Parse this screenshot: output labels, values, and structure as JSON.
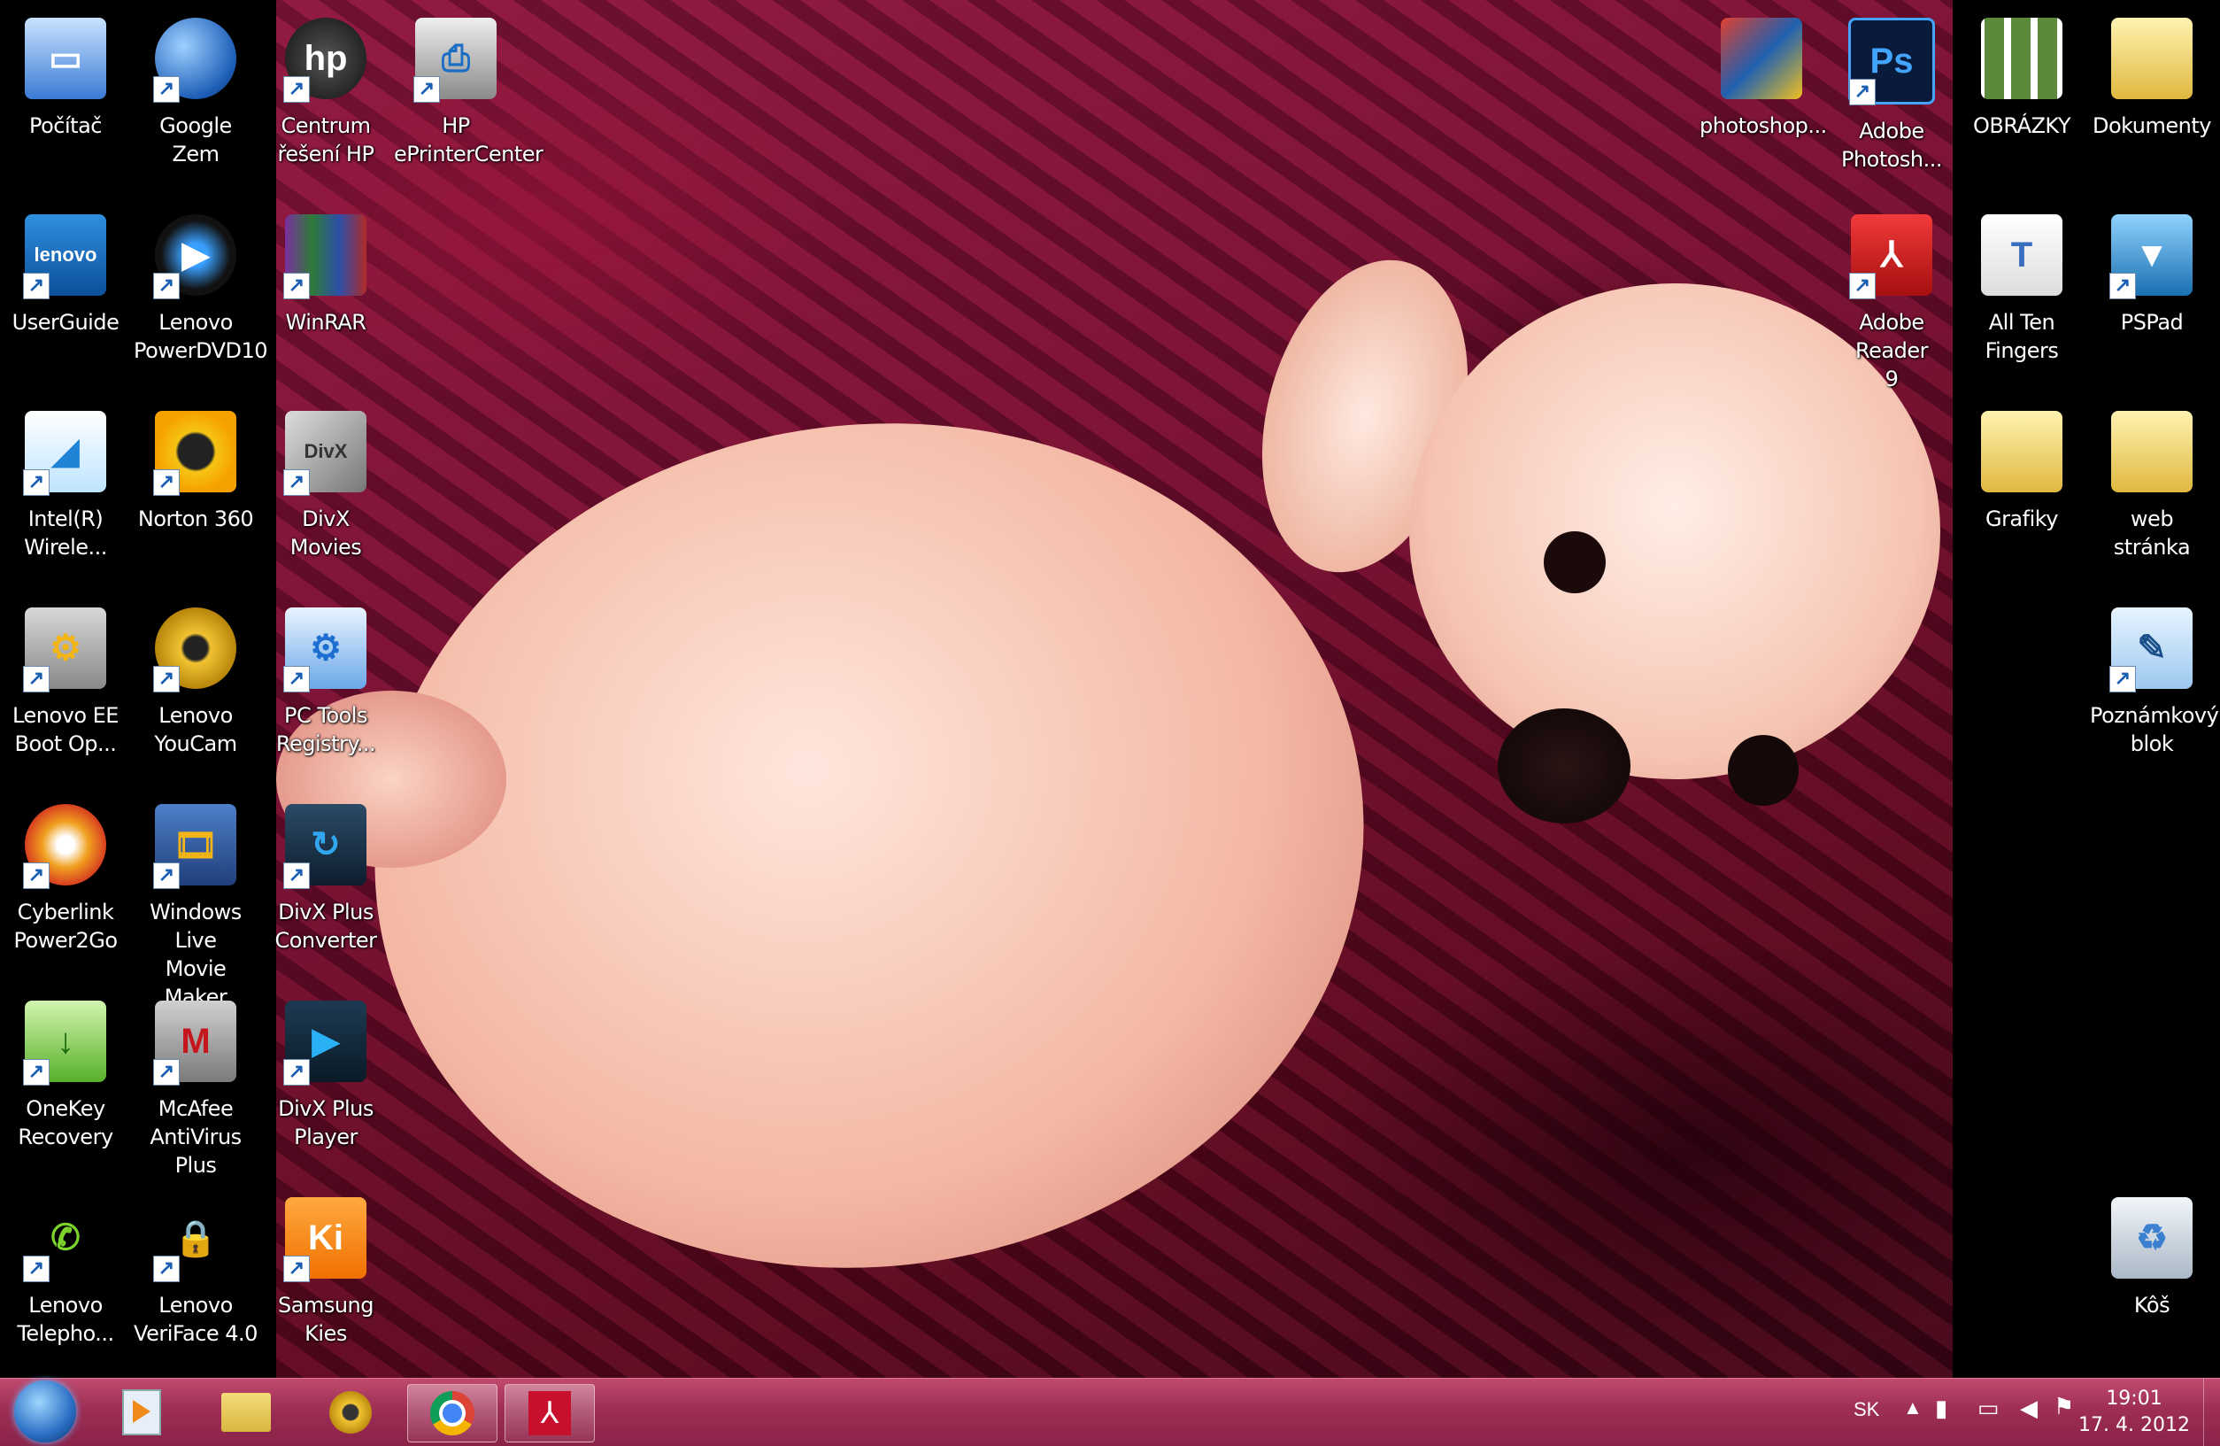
{
  "desktop_icons_left": [
    {
      "id": "pocitac",
      "label": "Počítač",
      "icon": "computer-icon",
      "col": 0,
      "row": 0
    },
    {
      "id": "google-zem",
      "label": "Google Zem",
      "icon": "google-earth-icon",
      "col": 1,
      "row": 0
    },
    {
      "id": "centrum-hp",
      "label": "Centrum\nřešení HP",
      "icon": "hp-icon",
      "col": 2,
      "row": 0
    },
    {
      "id": "hp-eprinter",
      "label": "HP\nePrinterCenter",
      "icon": "printer-icon",
      "col": 3,
      "row": 0
    },
    {
      "id": "userguide",
      "label": "UserGuide",
      "icon": "lenovo-icon",
      "col": 0,
      "row": 1
    },
    {
      "id": "powerdvd",
      "label": "Lenovo\nPowerDVD10",
      "icon": "dvd-player-icon",
      "col": 1,
      "row": 1
    },
    {
      "id": "winrar",
      "label": "WinRAR",
      "icon": "winrar-icon",
      "col": 2,
      "row": 1
    },
    {
      "id": "intel-wireless",
      "label": "Intel(R)\nWirele...",
      "icon": "wireless-icon",
      "col": 0,
      "row": 2
    },
    {
      "id": "norton",
      "label": "Norton 360",
      "icon": "norton-icon",
      "col": 1,
      "row": 2
    },
    {
      "id": "divx-movies",
      "label": "DivX Movies",
      "icon": "divx-icon",
      "col": 2,
      "row": 2
    },
    {
      "id": "lenovo-ee",
      "label": "Lenovo EE\nBoot Op...",
      "icon": "gear-shield-icon",
      "col": 0,
      "row": 3
    },
    {
      "id": "youcam",
      "label": "Lenovo\nYouCam",
      "icon": "webcam-icon",
      "col": 1,
      "row": 3
    },
    {
      "id": "pc-tools",
      "label": "PC Tools\nRegistry...",
      "icon": "registry-icon",
      "col": 2,
      "row": 3
    },
    {
      "id": "power2go",
      "label": "Cyberlink\nPower2Go",
      "icon": "disc-burn-icon",
      "col": 0,
      "row": 4
    },
    {
      "id": "movie-maker",
      "label": "Windows Live\nMovie Maker",
      "icon": "film-icon",
      "col": 1,
      "row": 4
    },
    {
      "id": "divx-converter",
      "label": "DivX Plus\nConverter",
      "icon": "converter-icon",
      "col": 2,
      "row": 4
    },
    {
      "id": "onekey",
      "label": "OneKey\nRecovery",
      "icon": "recovery-icon",
      "col": 0,
      "row": 5
    },
    {
      "id": "mcafee",
      "label": "McAfee\nAntiVirus Plus",
      "icon": "mcafee-icon",
      "col": 1,
      "row": 5
    },
    {
      "id": "divx-player",
      "label": "DivX Plus\nPlayer",
      "icon": "play-icon",
      "col": 2,
      "row": 5
    },
    {
      "id": "lenovo-telephony",
      "label": "Lenovo\nTelepho...",
      "icon": "phone-icon",
      "col": 0,
      "row": 6
    },
    {
      "id": "veriface",
      "label": "Lenovo\nVeriFace 4.0",
      "icon": "lock-face-icon",
      "col": 1,
      "row": 6
    },
    {
      "id": "kies",
      "label": "Samsung Kies",
      "icon": "kies-icon",
      "col": 2,
      "row": 6
    }
  ],
  "desktop_icons_right": [
    {
      "id": "photoshop-file",
      "label": "photoshop...",
      "icon": "photoshop-book-icon",
      "col": 0,
      "row": 0
    },
    {
      "id": "adobe-ps",
      "label": "Adobe\nPhotosh...",
      "icon": "photoshop-icon",
      "col": 1,
      "row": 0
    },
    {
      "id": "obrazky",
      "label": "OBRÁZKY",
      "icon": "image-grid-icon",
      "col": 2,
      "row": 0
    },
    {
      "id": "dokumenty",
      "label": "Dokumenty",
      "icon": "folder-icon",
      "col": 3,
      "row": 0
    },
    {
      "id": "adobe-reader",
      "label": "Adobe Reader\n9",
      "icon": "acrobat-icon",
      "col": 1,
      "row": 1
    },
    {
      "id": "all-ten",
      "label": "All Ten\nFingers",
      "icon": "font-file-icon",
      "col": 2,
      "row": 1
    },
    {
      "id": "pspad",
      "label": "PSPad",
      "icon": "pspad-icon",
      "col": 3,
      "row": 1
    },
    {
      "id": "grafiky",
      "label": "Grafiky",
      "icon": "folder-icon",
      "col": 2,
      "row": 2
    },
    {
      "id": "web-stranka",
      "label": "web stránka",
      "icon": "folder-icon",
      "col": 3,
      "row": 2
    },
    {
      "id": "poznamkovy",
      "label": "Poznámkový\nblok",
      "icon": "notepad-icon",
      "col": 3,
      "row": 3
    },
    {
      "id": "kos",
      "label": "Kôš",
      "icon": "recycle-bin-icon",
      "col": 3,
      "row": 6
    }
  ],
  "taskbar": {
    "start_icon": "windows-start-icon",
    "items": [
      {
        "id": "media-player",
        "icon": "media-player-icon"
      },
      {
        "id": "explorer",
        "icon": "file-explorer-icon"
      },
      {
        "id": "youcam",
        "icon": "webcam-icon"
      },
      {
        "id": "chrome",
        "icon": "chrome-icon",
        "active": true
      },
      {
        "id": "acrobat",
        "icon": "acrobat-icon",
        "active": true
      }
    ],
    "language": "SK",
    "tray_icons": [
      "show-hidden-icon",
      "power-icon",
      "network-icon",
      "volume-icon",
      "flag-icon"
    ],
    "time": "19:01",
    "date": "17. 4. 2012"
  },
  "colors": {
    "taskbar": "#9e2e55",
    "wallpaper": "#6d1030",
    "icon_text": "#ffffff"
  }
}
